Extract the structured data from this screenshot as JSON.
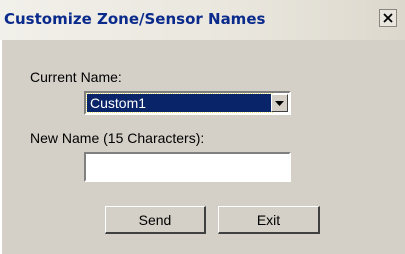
{
  "window": {
    "title": "Customize Zone/Sensor Names",
    "close_icon": "close-icon"
  },
  "current_name": {
    "label": "Current Name:",
    "selected": "Custom1",
    "dropdown_icon": "chevron-down-icon"
  },
  "new_name": {
    "label": "New Name (15 Characters):",
    "value": ""
  },
  "buttons": {
    "send": "Send",
    "exit": "Exit"
  },
  "colors": {
    "title_text": "#0a2a8c",
    "dialog_bg": "#d4d0c8",
    "selection_bg": "#0a246a"
  }
}
